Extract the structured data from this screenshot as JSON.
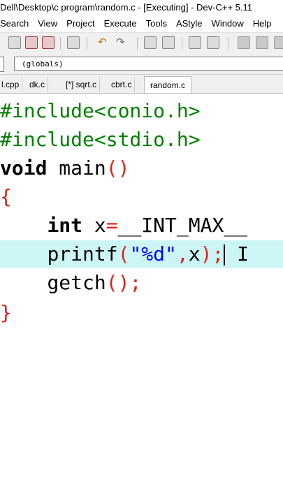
{
  "window": {
    "title": "Dell\\Desktop\\c program\\random.c - [Executing] - Dev-C++ 5.11"
  },
  "menu": {
    "items": [
      "Search",
      "View",
      "Project",
      "Execute",
      "Tools",
      "AStyle",
      "Window",
      "Help"
    ]
  },
  "toolbar": {
    "icons": [
      "open-project-icon",
      "save-all-icon",
      "close-icon",
      "print-icon",
      "undo-icon",
      "redo-icon",
      "find-icon",
      "replace-icon",
      "toggle-comment-icon",
      "indent-icon",
      "compile-icon",
      "run-icon"
    ]
  },
  "scope": {
    "value": "(globals)"
  },
  "tabs": [
    {
      "label": "l.cpp"
    },
    {
      "label": "dk.c"
    },
    {
      "label": "[*] sqrt.c"
    },
    {
      "label": "cbrt.c"
    },
    {
      "label": "random.c"
    }
  ],
  "code": {
    "l1": {
      "text": "#include<conio.h>"
    },
    "l2": {
      "text": "#include<stdio.h>"
    },
    "l3": {
      "kw": "void",
      "name": " main",
      "paren": "()"
    },
    "l4": {
      "brace": "{"
    },
    "l5": {
      "indent": "    ",
      "kw": "int",
      "sp": " ",
      "var": "x",
      "eq": "=",
      "macro": "__INT_MAX__"
    },
    "l6": {
      "indent": "    ",
      "fn": "printf",
      "open": "(",
      "str": "\"%d\"",
      "comma": ",",
      "var": "x",
      "close": ");",
      "rest": " I"
    },
    "l7": {
      "indent": "    ",
      "fn": "getch",
      "call": "();"
    },
    "l8": {
      "brace": "}"
    }
  },
  "colors": {
    "preprocessor": "#008000",
    "symbol": "#e0201a",
    "string": "#0000ff",
    "current_line": "#ccf6f6"
  }
}
